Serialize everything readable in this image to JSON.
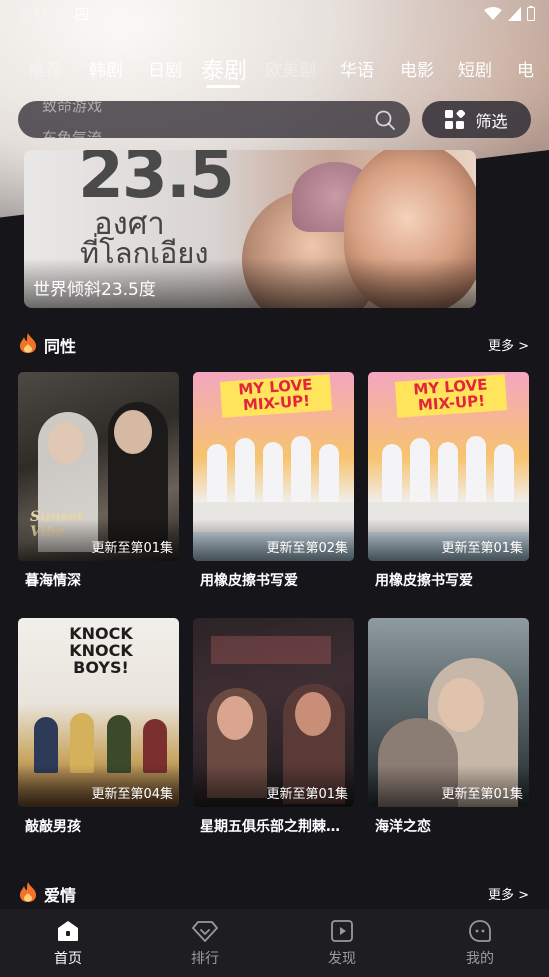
{
  "status_bar": {
    "time": "6:41",
    "a_label": "A"
  },
  "tabs": {
    "items": [
      {
        "label": "推荐",
        "state": "faded"
      },
      {
        "label": "韩剧",
        "state": "normal"
      },
      {
        "label": "日剧",
        "state": "normal"
      },
      {
        "label": "泰剧",
        "state": "active"
      },
      {
        "label": "欧美剧",
        "state": "faded"
      },
      {
        "label": "华语",
        "state": "normal"
      },
      {
        "label": "电影",
        "state": "normal"
      },
      {
        "label": "短剧",
        "state": "normal"
      },
      {
        "label": "电",
        "state": "normal"
      }
    ]
  },
  "search": {
    "hint_prev": "致命游戏",
    "hint_next": "东鱼气流"
  },
  "filter": {
    "label": "筛选"
  },
  "banner": {
    "title": "世界倾斜23.5度",
    "art_number": "23.5",
    "art_thai_line1": "องศา",
    "art_thai_line2": "ที่โลกเอียง"
  },
  "sections": [
    {
      "title": "同性",
      "more": "更多 >",
      "cards": [
        {
          "name": "暮海情深",
          "episode": "更新至第01集",
          "art": "sunset",
          "art_text": "Sunset\nVibe"
        },
        {
          "name": "用橡皮擦书写爱",
          "episode": "更新至第02集",
          "art": "mylove",
          "art_text": "MY LOVE\nMIX-UP!"
        },
        {
          "name": "用橡皮擦书写爱",
          "episode": "更新至第01集",
          "art": "mylove",
          "art_text": "MY LOVE\nMIX-UP!"
        },
        {
          "name": "敲敲男孩",
          "episode": "更新至第04集",
          "art": "knock",
          "art_text": "KNOCK\nKNOCK\nBOYS!"
        },
        {
          "name": "星期五俱乐部之荆棘…",
          "episode": "更新至第01集",
          "art": "friday",
          "art_text": ""
        },
        {
          "name": "海洋之恋",
          "episode": "更新至第01集",
          "art": "ocean",
          "art_text": ""
        }
      ]
    },
    {
      "title": "爱情",
      "more": "更多 >"
    }
  ],
  "bottom_nav": {
    "items": [
      {
        "label": "首页",
        "active": true
      },
      {
        "label": "排行",
        "active": false
      },
      {
        "label": "发现",
        "active": false
      },
      {
        "label": "我的",
        "active": false
      }
    ]
  },
  "colors": {
    "background": "#16151a",
    "accent_flame": "#f2722b",
    "nav_bg": "#1e1d22"
  }
}
